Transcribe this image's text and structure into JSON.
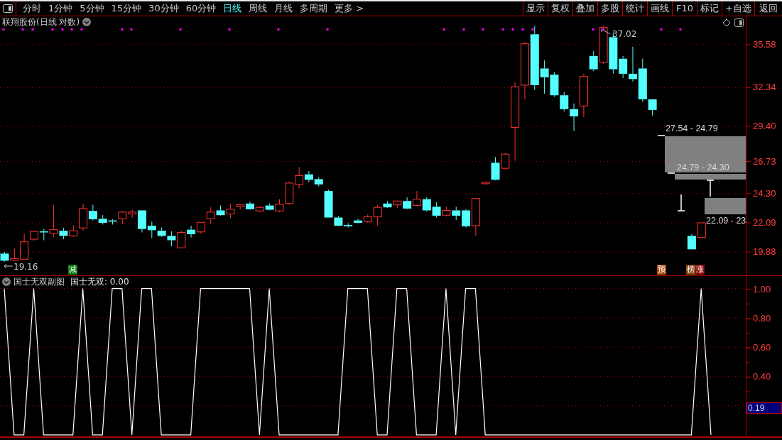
{
  "toolbar": {
    "period_tabs": [
      {
        "label": "分时",
        "selected": false
      },
      {
        "label": "1分钟",
        "selected": false
      },
      {
        "label": "5分钟",
        "selected": false
      },
      {
        "label": "15分钟",
        "selected": false
      },
      {
        "label": "30分钟",
        "selected": false
      },
      {
        "label": "60分钟",
        "selected": false
      },
      {
        "label": "日线",
        "selected": true
      },
      {
        "label": "周线",
        "selected": false
      },
      {
        "label": "月线",
        "selected": false
      },
      {
        "label": "多周期",
        "selected": false
      },
      {
        "label": "更多 >",
        "selected": false
      }
    ],
    "buttons": [
      "显示",
      "复权",
      "叠加",
      "多股",
      "统计",
      "画线",
      "F10",
      "标记",
      "+自选",
      "返回"
    ]
  },
  "main_chart": {
    "title": "联翔股份(日线 对数)",
    "chart_data": {
      "type": "candlestick",
      "grid": true,
      "ylim": [
        18.11,
        37.73
      ],
      "yticks": [
        {
          "value": 35.58,
          "label": "35.58"
        },
        {
          "value": 32.34,
          "label": "32.34"
        },
        {
          "value": 29.4,
          "label": "29.40"
        },
        {
          "value": 26.73,
          "label": "26.73"
        },
        {
          "value": 24.3,
          "label": "24.30"
        },
        {
          "value": 22.09,
          "label": "22.09"
        },
        {
          "value": 19.88,
          "label": "19.88"
        }
      ],
      "ohlc": [
        [
          19.76,
          19.88,
          19.16,
          19.22
        ],
        [
          19.26,
          20.16,
          19.22,
          19.37
        ],
        [
          19.33,
          21.23,
          19.33,
          20.65
        ],
        [
          20.85,
          21.49,
          20.73,
          21.44
        ],
        [
          21.44,
          21.62,
          20.77,
          21.36
        ],
        [
          21.27,
          23.45,
          21.02,
          21.57
        ],
        [
          21.49,
          21.7,
          20.85,
          21.1
        ],
        [
          21.1,
          21.92,
          21.02,
          21.49
        ],
        [
          21.7,
          23.55,
          21.49,
          23.17
        ],
        [
          22.99,
          23.45,
          22.27,
          22.36
        ],
        [
          22.4,
          22.67,
          21.96,
          22.09
        ],
        [
          22.27,
          22.36,
          21.96,
          22.18
        ],
        [
          22.4,
          22.99,
          22.0,
          22.9
        ],
        [
          22.76,
          23.08,
          22.45,
          22.9
        ],
        [
          23.03,
          23.03,
          21.36,
          21.62
        ],
        [
          21.87,
          22.18,
          20.94,
          21.53
        ],
        [
          21.49,
          21.74,
          21.02,
          21.1
        ],
        [
          21.1,
          21.44,
          20.32,
          20.77
        ],
        [
          20.2,
          21.49,
          20.2,
          21.36
        ],
        [
          21.57,
          21.87,
          20.98,
          21.23
        ],
        [
          21.4,
          22.13,
          21.27,
          22.13
        ],
        [
          22.4,
          23.26,
          22.0,
          22.9
        ],
        [
          23.03,
          23.4,
          22.63,
          22.67
        ],
        [
          22.76,
          23.55,
          22.45,
          23.12
        ],
        [
          23.31,
          23.45,
          23.12,
          23.45
        ],
        [
          23.55,
          23.69,
          23.08,
          23.12
        ],
        [
          22.99,
          23.35,
          22.9,
          23.26
        ],
        [
          23.4,
          23.55,
          23.03,
          23.08
        ],
        [
          22.99,
          23.88,
          22.9,
          23.5
        ],
        [
          23.55,
          25.2,
          23.45,
          25.1
        ],
        [
          25.0,
          26.32,
          24.7,
          25.66
        ],
        [
          25.76,
          26.01,
          25.15,
          25.35
        ],
        [
          25.4,
          25.56,
          24.85,
          25.0
        ],
        [
          24.5,
          24.6,
          22.49,
          22.49
        ],
        [
          22.49,
          22.63,
          21.83,
          21.87
        ],
        [
          21.92,
          22.05,
          21.74,
          21.83
        ],
        [
          22.27,
          22.4,
          22.05,
          22.09
        ],
        [
          22.18,
          22.72,
          22.09,
          22.54
        ],
        [
          22.54,
          23.45,
          21.87,
          23.26
        ],
        [
          23.55,
          23.74,
          23.22,
          23.26
        ],
        [
          23.45,
          23.78,
          23.22,
          23.74
        ],
        [
          23.74,
          24.02,
          23.12,
          23.17
        ],
        [
          23.4,
          24.5,
          23.4,
          23.88
        ],
        [
          23.88,
          24.02,
          22.94,
          23.03
        ],
        [
          23.31,
          23.64,
          22.49,
          22.63
        ],
        [
          22.67,
          23.31,
          22.58,
          23.03
        ],
        [
          23.03,
          23.31,
          22.31,
          22.63
        ],
        [
          23.03,
          23.12,
          21.74,
          21.83
        ],
        [
          21.87,
          23.98,
          21.1,
          23.93
        ],
        [
          25.05,
          25.2,
          25.0,
          25.15
        ],
        [
          26.64,
          27.07,
          25.3,
          25.35
        ],
        [
          26.22,
          27.4,
          26.11,
          27.29
        ],
        [
          29.32,
          32.72,
          26.8,
          32.39
        ],
        [
          32.52,
          35.79,
          31.44,
          35.65
        ],
        [
          36.37,
          37.0,
          32.14,
          32.52
        ],
        [
          33.78,
          34.39,
          31.88,
          33.11
        ],
        [
          33.31,
          33.51,
          31.63,
          31.75
        ],
        [
          31.75,
          32.01,
          30.51,
          30.7
        ],
        [
          30.7,
          31.13,
          29.03,
          30.15
        ],
        [
          30.94,
          33.38,
          30.09,
          33.18
        ],
        [
          34.73,
          35.08,
          33.58,
          33.72
        ],
        [
          34.25,
          37.02,
          34.12,
          36.9
        ],
        [
          36.15,
          36.51,
          33.38,
          33.72
        ],
        [
          34.52,
          34.73,
          33.05,
          33.38
        ],
        [
          33.38,
          35.43,
          32.78,
          32.98
        ],
        [
          33.78,
          34.52,
          31.25,
          31.44
        ],
        [
          31.44,
          31.44,
          30.21,
          30.64
        ],
        null,
        null,
        null,
        [
          21.1,
          21.23,
          20.08,
          20.08
        ],
        [
          20.98,
          22.09,
          20.98,
          22.09
        ],
        null,
        null,
        null,
        null
      ]
    },
    "low_marker": "19.16",
    "high_marker": "37.02",
    "badges": [
      {
        "text": "减",
        "color": "#0f7d0f"
      },
      {
        "text": "预",
        "color": "#b0501c"
      },
      {
        "text": "榜",
        "color": "#8a4c16"
      },
      {
        "text": "涨",
        "color": "#8c0a0a"
      }
    ],
    "zones": [
      {
        "label": "27.54 - 24.79"
      },
      {
        "label": "24.79 - 24.30"
      },
      {
        "label": "22.09 - 23"
      }
    ]
  },
  "indicator": {
    "title": "国士无双副图",
    "reading": "国士无双: 0.00",
    "current_value": "0.19",
    "chart_data": {
      "type": "line",
      "grid": true,
      "ylim": [
        -0.02,
        1.09
      ],
      "yticks": [
        {
          "value": 0.4,
          "label": "0.40"
        },
        {
          "value": 0.6,
          "label": "0.60"
        },
        {
          "value": 0.8,
          "label": "0.80"
        },
        {
          "value": 1,
          "label": "1.00"
        }
      ],
      "series": [
        {
          "color": "#ffffff",
          "values": [
            1,
            0,
            0,
            1,
            0,
            0,
            0,
            0,
            1,
            0,
            0,
            1,
            1,
            0,
            1,
            1,
            0,
            0,
            0,
            0,
            1,
            1,
            1,
            1,
            1,
            1,
            0,
            1,
            0,
            0,
            0,
            0,
            0,
            0,
            0,
            1,
            1,
            1,
            0,
            0,
            1,
            1,
            0,
            0,
            0,
            1,
            0,
            1,
            1,
            0,
            0,
            0,
            0,
            0,
            0,
            0,
            0,
            0,
            0,
            0,
            0,
            0,
            0,
            0,
            0,
            0,
            0,
            0,
            0,
            0,
            0,
            1,
            0
          ]
        }
      ]
    }
  }
}
